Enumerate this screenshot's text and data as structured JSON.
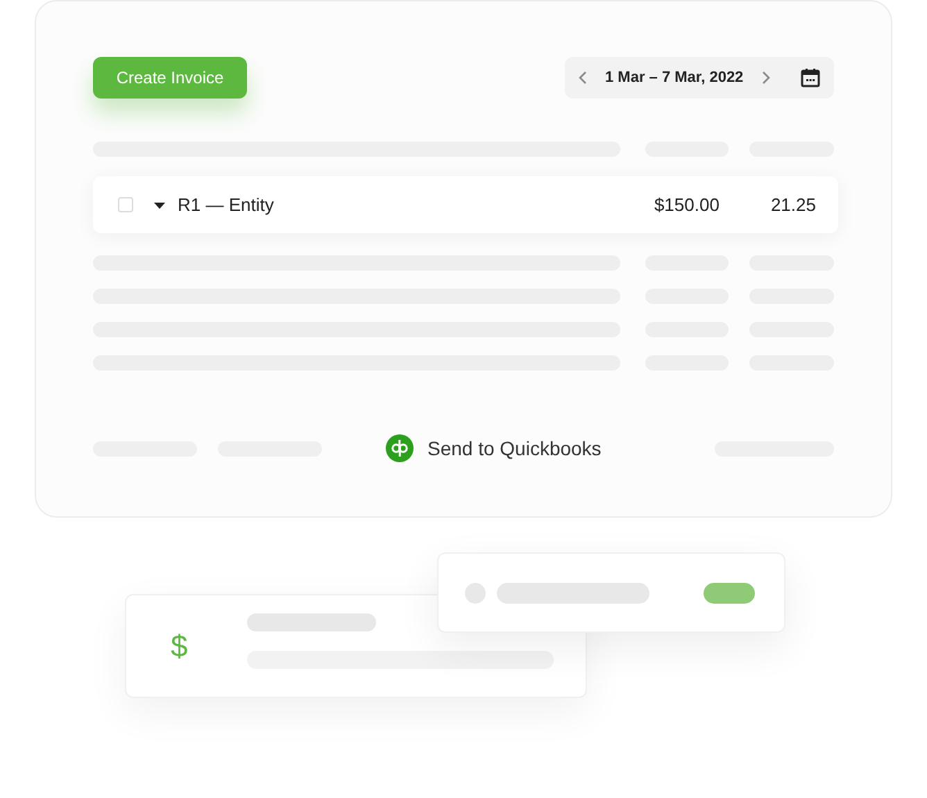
{
  "create_button": {
    "label": "Create Invoice"
  },
  "date_range": {
    "label": "1 Mar – 7 Mar, 2022"
  },
  "row": {
    "checked": false,
    "expanded": true,
    "name": "R1 — Entity",
    "amount": "$150.00",
    "hours": "21.25"
  },
  "footer": {
    "action": "Send to Quickbooks"
  },
  "summary_card": {
    "symbol": "$"
  }
}
